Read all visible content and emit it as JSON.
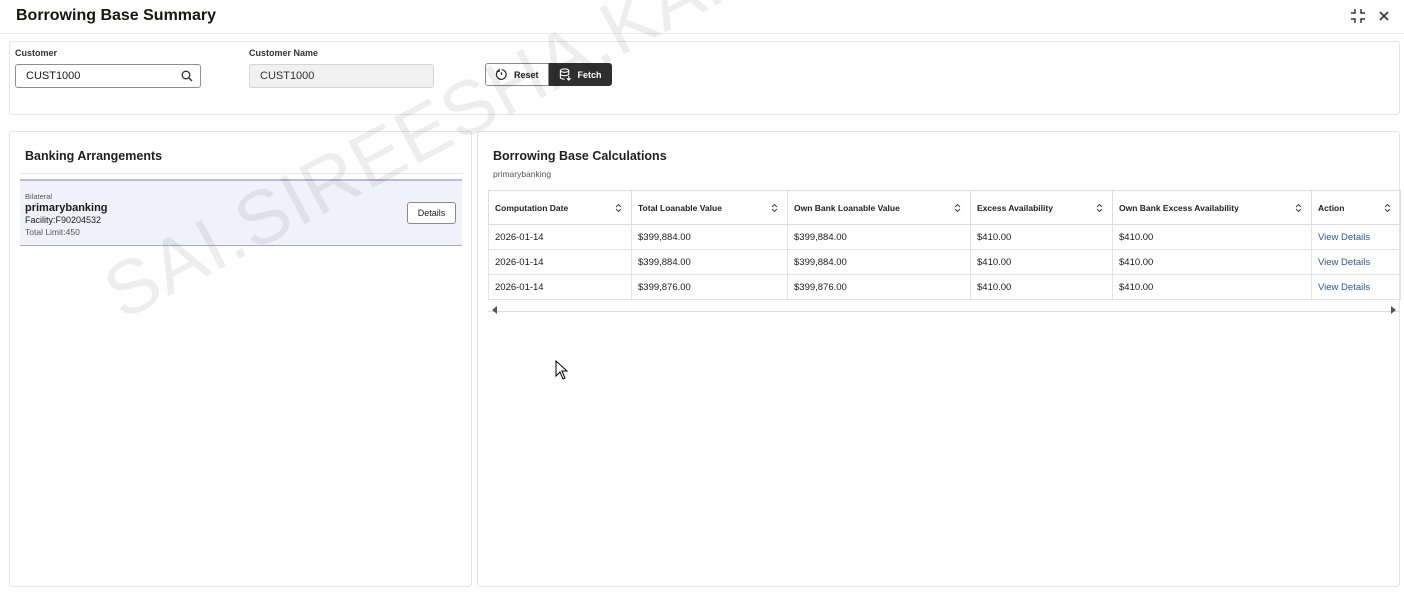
{
  "window": {
    "title": "Borrowing Base Summary"
  },
  "filters": {
    "customer_label": "Customer",
    "customer_value": "CUST1000",
    "customer_name_label": "Customer Name",
    "customer_name_value": "CUST1000",
    "reset_label": "Reset",
    "fetch_label": "Fetch"
  },
  "banking": {
    "title": "Banking Arrangements",
    "arrangement": {
      "type": "Bilateral",
      "name": "primarybanking",
      "facility": "Facility:F90204532",
      "limit": "Total Limit:450",
      "details_label": "Details"
    }
  },
  "calc": {
    "title": "Borrowing Base Calculations",
    "subtitle": "primarybanking",
    "columns": [
      "Computation Date",
      "Total Loanable Value",
      "Own Bank Loanable Value",
      "Excess Availability",
      "Own Bank Excess Availability",
      "Action"
    ],
    "rows": [
      [
        "2026-01-14",
        "$399,884.00",
        "$399,884.00",
        "$410.00",
        "$410.00",
        "View Details"
      ],
      [
        "2026-01-14",
        "$399,884.00",
        "$399,884.00",
        "$410.00",
        "$410.00",
        "View Details"
      ],
      [
        "2026-01-14",
        "$399,876.00",
        "$399,876.00",
        "$410.00",
        "$410.00",
        "View Details"
      ]
    ]
  },
  "watermark": "SAI.SIREESHA.KARRI@ORACLE.COM",
  "icons": {
    "search": "search-icon",
    "reset": "reset-icon",
    "fetch": "fetch-icon",
    "collapse": "collapse-icon",
    "close": "close-icon",
    "sort": "sort-icon",
    "scroll_left": "scroll-left-icon",
    "scroll_right": "scroll-right-icon"
  },
  "colors": {
    "link": "#2c5a8c",
    "fetch_bg": "#2f2f2f",
    "card_bg": "#f1f1fb"
  }
}
